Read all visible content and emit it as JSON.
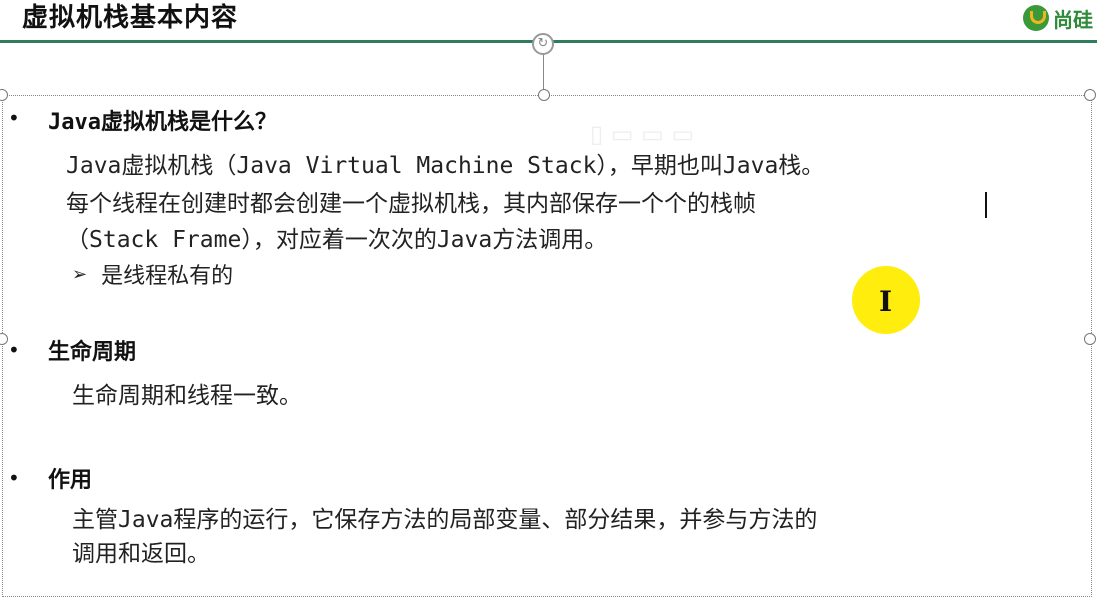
{
  "header": {
    "title": "虚拟机栈基本内容",
    "logo_text": "尚硅"
  },
  "sections": [
    {
      "heading": "Java虚拟机栈是什么？",
      "lines": [
        "Java虚拟机栈（Java Virtual Machine Stack），早期也叫Java栈。",
        "每个线程在创建时都会创建一个虚拟机栈，其内部保存一个个的栈帧",
        "（Stack Frame），对应着一次次的Java方法调用。"
      ],
      "sub_items": [
        "是线程私有的"
      ]
    },
    {
      "heading": "生命周期",
      "lines": [
        "生命周期和线程一致。"
      ]
    },
    {
      "heading": "作用",
      "lines": [
        "主管Java程序的运行，它保存方法的局部变量、部分结果，并参与方法的",
        "调用和返回。"
      ]
    }
  ],
  "colors": {
    "title_rule": "#2e7d5b",
    "cursor_highlight": "#ffec00",
    "logo_green": "#2e8b3a"
  },
  "icons": {
    "bullet": "•",
    "sub_bullet": "➢",
    "cursor": "I"
  }
}
